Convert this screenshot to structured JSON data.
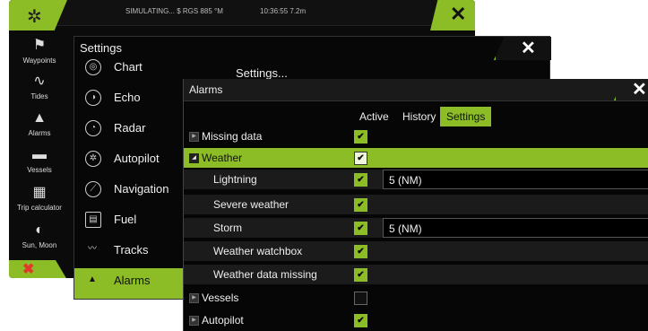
{
  "topbar": {
    "status": "SIMULATING...   $ RGS 885 °M",
    "clock": "10:36:55   7.2m"
  },
  "sidebar": {
    "items": [
      {
        "label": "Waypoints",
        "icon": "flag-icon"
      },
      {
        "label": "Tides",
        "icon": "wave-icon"
      },
      {
        "label": "Alarms",
        "icon": "bell-icon"
      },
      {
        "label": "Vessels",
        "icon": "vessels-icon"
      },
      {
        "label": "Trip calculator",
        "icon": "calculator-icon"
      },
      {
        "label": "Sun, Moon",
        "icon": "sun-moon-icon"
      }
    ]
  },
  "settings": {
    "title": "Settings",
    "hint": "Settings...",
    "items": [
      {
        "label": "Chart",
        "icon": "chart-icon"
      },
      {
        "label": "Echo",
        "icon": "echo-icon"
      },
      {
        "label": "Radar",
        "icon": "radar-icon"
      },
      {
        "label": "Autopilot",
        "icon": "autopilot-icon"
      },
      {
        "label": "Navigation",
        "icon": "navigation-icon"
      },
      {
        "label": "Fuel",
        "icon": "fuel-icon"
      },
      {
        "label": "Tracks",
        "icon": "tracks-icon"
      },
      {
        "label": "Alarms",
        "icon": "bell-icon",
        "selected": true
      }
    ]
  },
  "alarms": {
    "title": "Alarms",
    "tabs": [
      "Active",
      "History",
      "Settings"
    ],
    "active_tab": "Settings",
    "rows": [
      {
        "label": "Missing data",
        "checked": true
      },
      {
        "label": "Weather",
        "checked": true,
        "expanded": true
      },
      {
        "label": "Lightning",
        "checked": true,
        "value": "5 (NM)"
      },
      {
        "label": "Severe weather",
        "checked": true
      },
      {
        "label": "Storm",
        "checked": true,
        "value": "5 (NM)"
      },
      {
        "label": "Weather watchbox",
        "checked": true
      },
      {
        "label": "Weather data missing",
        "checked": true
      },
      {
        "label": "Vessels",
        "checked": false
      },
      {
        "label": "Autopilot",
        "checked": true
      }
    ]
  },
  "colors": {
    "accent": "#8cbd27",
    "background": "#070707"
  }
}
